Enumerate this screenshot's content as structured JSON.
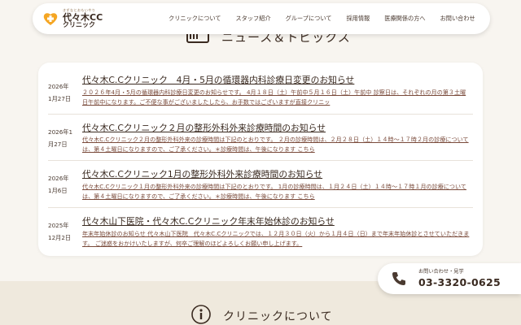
{
  "header": {
    "logo": {
      "sub": "きずなとおもいやり",
      "name": "代々木CC",
      "name2": "クリニック"
    },
    "nav": [
      "クリニックについて",
      "スタッフ紹介",
      "グループについて",
      "採用情報",
      "医療関係の方へ",
      "お問い合わせ"
    ]
  },
  "news_section": {
    "title": "ニュース＆トピックス",
    "items": [
      {
        "date_year": "2026年",
        "date_day": "1月27日",
        "title": "代々木C.Cクリニック　4月・5月の循環器内科診療日変更のお知らせ",
        "body": "２０２６年4月・5月の循環器内科診療日変更のお知らせです。 4月１８日（土）午前中５月１６日（土）午前中 診察日は、それぞれの月の第３土曜日午前中になります。ご不便な事がございましたしたら、お手数ではございますが直接クリニッ"
      },
      {
        "date_year": "2026年1",
        "date_day": "月27日",
        "title": "代々木C.Cクリニック２月の整形外科外来診療時間のお知らせ",
        "body": "代々木C.Cクリニック２月の整形外科外来の診療時間は下記のとおりです。 ２月の診療時間は、２月２８日（土）１４時～１７時２月の診療については、第４土曜日になりますので、ご了承ください。＊診療時間は、午後になります こちら"
      },
      {
        "date_year": "2026年",
        "date_day": "1月6日",
        "title": "代々木C.Cクリニック1月の整形外科外来診療時間のお知らせ",
        "body": "代々木C.Cクリニック１月の整形外科外来の診療時間は下記のとおりです。 1月の診療時間は、１月２４日（土）１４時～１７時１月の診療については、第４土曜日になりますので、ご了承ください。＊診療時間は、午後になります こちら"
      },
      {
        "date_year": "2025年",
        "date_day": "12月2日",
        "title": "代々木山下医院・代々木C.Cクリニック年末年始休診のお知らせ",
        "body": "年末年始休診のお知らせ 代々木山下医院　代々木C.Cクリニックでは、１２月３０日（火）から１月４日（日）まで年末年始休診とさせていただきます。 ご迷惑をおかけいたしますが、何卒ご理解のほどよろしくお願い申し上げます。"
      }
    ]
  },
  "about_section": {
    "title": "クリニックについて"
  },
  "contact": {
    "label": "お問い合わせ・見学",
    "phone": "03-3320-0625"
  },
  "colors": {
    "accent": "#f5a623",
    "background": "#f8f5f0",
    "band": "#efe9dd"
  }
}
